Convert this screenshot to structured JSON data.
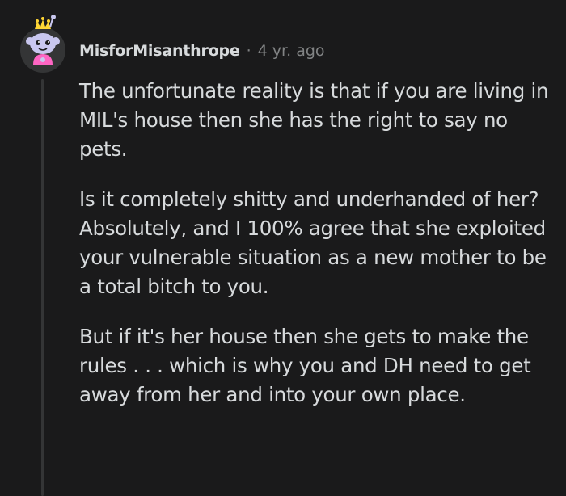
{
  "comment": {
    "username": "MisforMisanthrope",
    "separator": "·",
    "age": "4 yr. ago",
    "paragraphs": [
      "The unfortunate reality is that if you are living in MIL's house then she has the right to say no pets.",
      "Is it completely shitty and underhanded of her? Absolutely, and I 100% agree that she exploited your vulnerable situation as a new mother to be a total bitch to you.",
      "But if it's her house then she gets to make the rules . . . which is why you and DH need to get away from her and into your own place."
    ]
  },
  "colors": {
    "background": "#1a1a1b",
    "text": "#d7dadc",
    "meta": "#818384",
    "thread_line": "#343536",
    "avatar_circle": "#343536",
    "avatar_face": "#c9c7ef",
    "avatar_shirt": "#ff66c4",
    "avatar_crown": "#ffd635"
  }
}
